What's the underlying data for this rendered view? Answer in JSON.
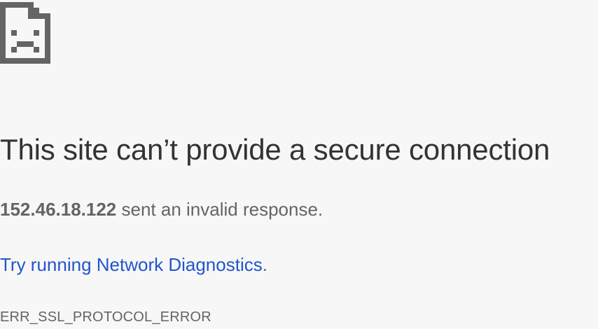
{
  "icon": "sad-page-icon",
  "colors": {
    "background": "#f7f7f7",
    "heading": "#333333",
    "body_text": "#646464",
    "link": "#2255cc",
    "icon": "#646464"
  },
  "error": {
    "heading": "This site can’t provide a secure connection",
    "host": "152.46.18.122",
    "message_suffix": " sent an invalid response.",
    "diagnostics_link": "Try running Network Diagnostics",
    "diagnostics_suffix": ".",
    "code": "ERR_SSL_PROTOCOL_ERROR"
  }
}
